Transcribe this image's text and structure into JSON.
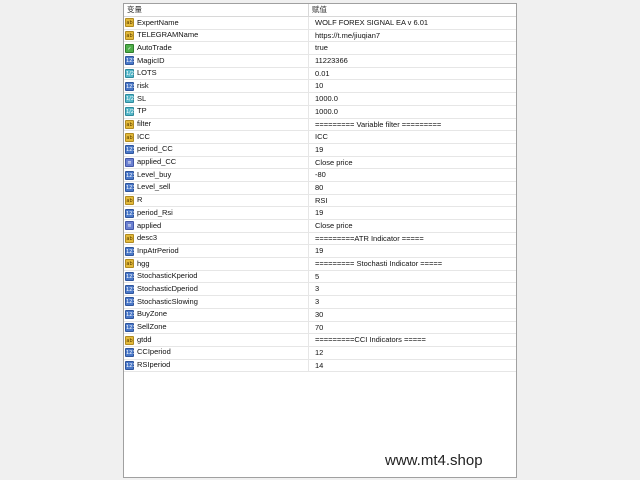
{
  "header": {
    "name_col": "变量",
    "value_col": "赋值"
  },
  "rows": [
    {
      "icon": "ab",
      "name": "ExpertName",
      "value": "WOLF FOREX SIGNAL EA v 6.01"
    },
    {
      "icon": "ab",
      "name": "TELEGRAMName",
      "value": "https://t.me/jiuqian7"
    },
    {
      "icon": "bool",
      "name": "AutoTrade",
      "value": "true"
    },
    {
      "icon": "num",
      "name": "MagicID",
      "value": "11223366"
    },
    {
      "icon": "dbl",
      "name": "LOTS",
      "value": "0.01"
    },
    {
      "icon": "num",
      "name": "risk",
      "value": "10"
    },
    {
      "icon": "dbl",
      "name": "SL",
      "value": "1000.0"
    },
    {
      "icon": "dbl",
      "name": "TP",
      "value": "1000.0"
    },
    {
      "icon": "ab",
      "name": "filter",
      "value": "========= Variable filter ========="
    },
    {
      "icon": "ab",
      "name": "ICC",
      "value": "ICC"
    },
    {
      "icon": "num",
      "name": "period_CC",
      "value": "19"
    },
    {
      "icon": "enm",
      "name": "applied_CC",
      "value": "Close price"
    },
    {
      "icon": "num",
      "name": "Level_buy",
      "value": "-80"
    },
    {
      "icon": "num",
      "name": "Level_sell",
      "value": "80"
    },
    {
      "icon": "ab",
      "name": "R",
      "value": "RSI"
    },
    {
      "icon": "num",
      "name": "period_Rsi",
      "value": "19"
    },
    {
      "icon": "enm",
      "name": "applied",
      "value": "Close price"
    },
    {
      "icon": "ab",
      "name": "desc3",
      "value": "=========ATR Indicator ====="
    },
    {
      "icon": "num",
      "name": "InpAtrPeriod",
      "value": "19"
    },
    {
      "icon": "ab",
      "name": "hgg",
      "value": "========= Stochasti Indicator ====="
    },
    {
      "icon": "num",
      "name": "StochasticKperiod",
      "value": "5"
    },
    {
      "icon": "num",
      "name": "StochasticDperiod",
      "value": "3"
    },
    {
      "icon": "num",
      "name": "StochasticSlowing",
      "value": "3"
    },
    {
      "icon": "num",
      "name": "BuyZone",
      "value": "30"
    },
    {
      "icon": "num",
      "name": "SellZone",
      "value": "70"
    },
    {
      "icon": "ab",
      "name": "gtdd",
      "value": "=========CCI Indicators ====="
    },
    {
      "icon": "num",
      "name": "CCIperiod",
      "value": "12"
    },
    {
      "icon": "num",
      "name": "RSIperiod",
      "value": "14"
    }
  ],
  "icon_glyphs": {
    "ab": "ab",
    "num": "123",
    "dbl": "1/2",
    "bool": "✓",
    "enm": "≡"
  },
  "watermark": "www.mt4.shop"
}
